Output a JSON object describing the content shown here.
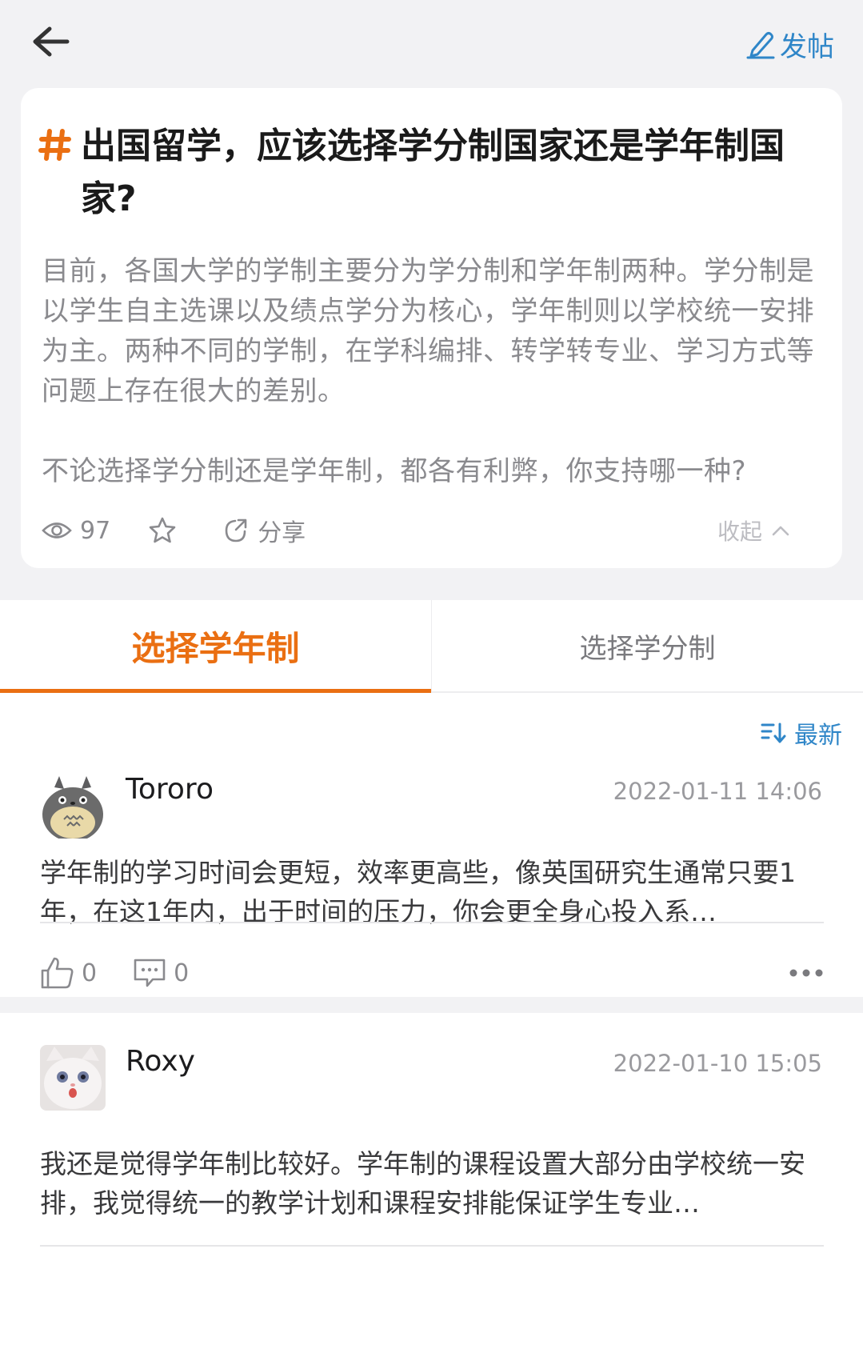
{
  "header": {
    "post_label": "发帖"
  },
  "topic": {
    "title": "出国留学，应该选择学分制国家还是学年制国家?",
    "description_p1": "目前，各国大学的学制主要分为学分制和学年制两种。学分制是以学生自主选课以及绩点学分为核心，学年制则以学校统一安排为主。两种不同的学制，在学科编排、转学转专业、学习方式等问题上存在很大的差别。",
    "description_p2": "不论选择学分制还是学年制，都各有利弊，你支持哪一种?",
    "views": "97",
    "share_label": "分享",
    "collapse_label": "收起"
  },
  "tabs": [
    {
      "label": "选择学年制",
      "active": true
    },
    {
      "label": "选择学分制",
      "active": false
    }
  ],
  "sort": {
    "label": "最新"
  },
  "posts": [
    {
      "username": "Tororo",
      "timestamp": "2022-01-11 14:06",
      "content": "学年制的学习时间会更短，效率更高些，像英国研究生通常只要1年，在这1年内，出于时间的压力，你会更全身心投入系…",
      "likes": "0",
      "comments": "0",
      "avatar_icon": "totoro-avatar"
    },
    {
      "username": "Roxy",
      "timestamp": "2022-01-10 15:05",
      "content": "我还是觉得学年制比较好。学年制的课程设置大部分由学校统一安排，我觉得统一的教学计划和课程安排能保证学生专业…",
      "avatar_icon": "cat-avatar"
    }
  ],
  "colors": {
    "accent": "#ea6f12",
    "link": "#2f86c8",
    "muted": "#8a8a8e"
  }
}
